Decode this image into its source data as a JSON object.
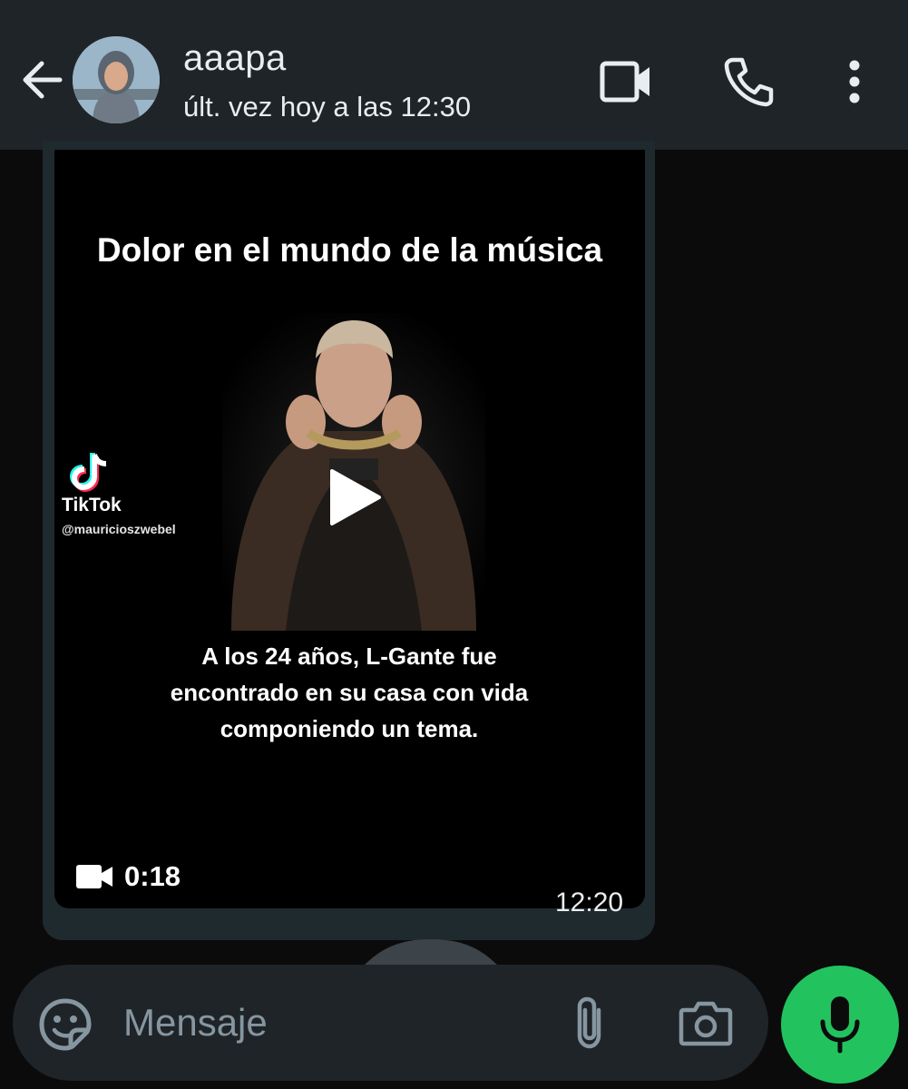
{
  "header": {
    "contact_name": "aaapa",
    "status": "últ. vez hoy a las 12:30",
    "icons": [
      "arrow-back-icon",
      "videocam-icon",
      "phone-icon",
      "more-vert-icon"
    ]
  },
  "message": {
    "media_title": "Dolor en el mundo de la música",
    "caption": "A los 24 años, L-Gante fue encontrado en su casa con vida componiendo un tema.",
    "watermark_brand": "TikTok",
    "watermark_handle": "@mauricioszwebel",
    "duration": "0:18",
    "time": "12:20"
  },
  "composer": {
    "placeholder": "Mensaje",
    "icons": [
      "sticker-icon",
      "attach-icon",
      "camera-icon",
      "mic-icon"
    ]
  },
  "colors": {
    "header_bg": "#1f2428",
    "chat_bg": "#0b0b0c",
    "bubble_bg": "#1f2a2f",
    "mic_button": "#22c35e",
    "text_primary": "#e9edef",
    "placeholder": "#8696a0"
  }
}
